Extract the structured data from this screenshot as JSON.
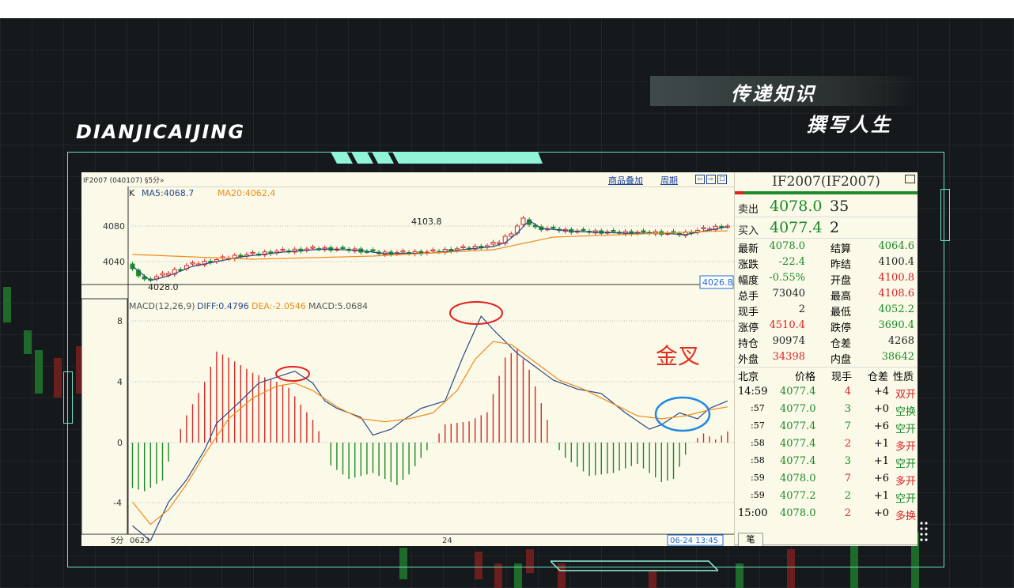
{
  "brand": "DIANJICAIJING",
  "slogan": {
    "line1": "传递知识",
    "line2": "撰写人生"
  },
  "chart": {
    "code": "IF2007 (040107) §5分»",
    "links": {
      "overlay": "商品叠加",
      "period": "周期"
    },
    "nav_buttons": [
      "⇦",
      "⇨",
      "☐"
    ],
    "kline": {
      "label_k": "K",
      "label_ma5": "MA5:4068.7",
      "label_ma20": "MA20:4062.4",
      "y_ticks": [
        "4080",
        "4040"
      ],
      "high_label": "4103.8",
      "low_label": "4028.0",
      "price_tag": "4026.8"
    },
    "macd": {
      "label": "MACD(12,26,9)",
      "diff": "DIFF:0.4796",
      "dea": "DEA:-2.0546",
      "macd": "MACD:5.0684",
      "y_ticks": [
        "8",
        "4",
        "0",
        "-4"
      ],
      "annotation": "金叉"
    },
    "xaxis": {
      "period": "5分",
      "start": "0623",
      "mid": "24",
      "cursor": "06-24 13:45"
    },
    "colors": {
      "up": "#d42a2a",
      "down": "#1e8a2a",
      "ma5": "#2a4a88",
      "ma20": "#f08a1a",
      "circle_red": "#e02020",
      "circle_blue": "#1e88e5"
    }
  },
  "quote": {
    "title": "IF2007(IF2007)",
    "ask": {
      "label": "卖出",
      "price": "4078.0",
      "vol": "35"
    },
    "bid": {
      "label": "买入",
      "price": "4077.4",
      "vol": "2"
    },
    "stats": [
      {
        "l1": "最新",
        "v1": "4078.0",
        "c1": "g",
        "l2": "结算",
        "v2": "4064.6",
        "c2": "g"
      },
      {
        "l1": "涨跌",
        "v1": "-22.4",
        "c1": "g",
        "l2": "昨结",
        "v2": "4100.4",
        "c2": "k"
      },
      {
        "l1": "幅度",
        "v1": "-0.55%",
        "c1": "g",
        "l2": "开盘",
        "v2": "4100.8",
        "c2": "r"
      },
      {
        "l1": "总手",
        "v1": "73040",
        "c1": "k",
        "l2": "最高",
        "v2": "4108.6",
        "c2": "r"
      },
      {
        "l1": "现手",
        "v1": "2",
        "c1": "k",
        "l2": "最低",
        "v2": "4052.2",
        "c2": "g"
      },
      {
        "l1": "涨停",
        "v1": "4510.4",
        "c1": "r",
        "l2": "跌停",
        "v2": "3690.4",
        "c2": "g"
      },
      {
        "l1": "持仓",
        "v1": "90974",
        "c1": "k",
        "l2": "仓差",
        "v2": "4268",
        "c2": "k"
      },
      {
        "l1": "外盘",
        "v1": "34398",
        "c1": "r",
        "l2": "内盘",
        "v2": "38642",
        "c2": "g"
      }
    ],
    "trades_head": {
      "city": "北京",
      "price": "价格",
      "vol": "现手",
      "diff": "仓差",
      "nature": "性质"
    },
    "trades": [
      {
        "time": "14:59",
        "price": "4077.4",
        "vol": "4",
        "vc": "r",
        "diff": "+4",
        "nature": "双开",
        "nc": "r"
      },
      {
        "time": ":57",
        "price": "4077.0",
        "vol": "3",
        "vc": "g",
        "diff": "+0",
        "nature": "空换",
        "nc": "g"
      },
      {
        "time": ":57",
        "price": "4077.4",
        "vol": "7",
        "vc": "g",
        "diff": "+6",
        "nature": "空开",
        "nc": "g"
      },
      {
        "time": ":58",
        "price": "4077.4",
        "vol": "2",
        "vc": "r",
        "diff": "+1",
        "nature": "多开",
        "nc": "r"
      },
      {
        "time": ":58",
        "price": "4077.4",
        "vol": "3",
        "vc": "g",
        "diff": "+1",
        "nature": "空开",
        "nc": "g"
      },
      {
        "time": ":59",
        "price": "4078.0",
        "vol": "7",
        "vc": "r",
        "diff": "+6",
        "nature": "多开",
        "nc": "r"
      },
      {
        "time": ":59",
        "price": "4077.2",
        "vol": "2",
        "vc": "g",
        "diff": "+1",
        "nature": "空开",
        "nc": "g"
      },
      {
        "time": "15:00",
        "price": "4078.0",
        "vol": "2",
        "vc": "r",
        "diff": "+0",
        "nature": "多换",
        "nc": "r"
      }
    ],
    "tab": "笔"
  }
}
